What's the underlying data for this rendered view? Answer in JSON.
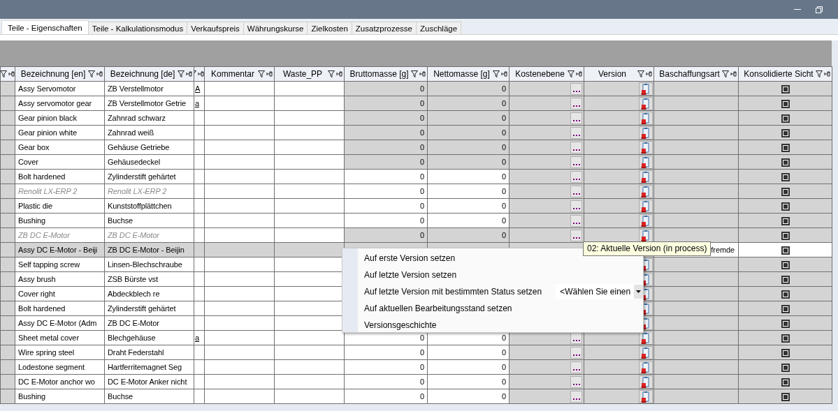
{
  "tabs": [
    {
      "label": "Teile - Eigenschaften",
      "selected": true
    },
    {
      "label": "Teile - Kalkulationsmodus",
      "selected": false
    },
    {
      "label": "Verkaufspreis",
      "selected": false
    },
    {
      "label": "Währungskurse",
      "selected": false
    },
    {
      "label": "Zielkosten",
      "selected": false
    },
    {
      "label": "Zusatzprozesse",
      "selected": false
    },
    {
      "label": "Zuschläge",
      "selected": false
    }
  ],
  "table": {
    "columns": [
      {
        "kind": "rowheader"
      },
      {
        "kind": "text",
        "label": "Bezeichnung [en]"
      },
      {
        "kind": "text",
        "label": "Bezeichnung [de]"
      },
      {
        "kind": "flag"
      },
      {
        "kind": "text",
        "label": "Kommentar"
      },
      {
        "kind": "text",
        "label": "Waste_PP"
      },
      {
        "kind": "number",
        "label": "Bruttomasse [g]"
      },
      {
        "kind": "number",
        "label": "Nettomasse [g]"
      },
      {
        "kind": "cost",
        "label": "Kostenebene"
      },
      {
        "kind": "version",
        "label": "Version"
      },
      {
        "kind": "procurement",
        "label": "Baschaffungsart"
      },
      {
        "kind": "check",
        "label": "Konsolidierte Sicht"
      }
    ],
    "rows": [
      {
        "en": "Assy Servomotor",
        "de": "ZB Verstellmotor",
        "flag": "A",
        "locked": true,
        "inactive": false,
        "selected": false,
        "brutto": "0",
        "netto": "0",
        "cost_button": true,
        "version_icon": true,
        "checked": true
      },
      {
        "en": "Assy servomotor gear",
        "de": "ZB Verstellmotor Getrie",
        "flag": "a",
        "locked": true,
        "inactive": false,
        "selected": false,
        "brutto": "0",
        "netto": "0",
        "cost_button": true,
        "version_icon": true,
        "checked": true
      },
      {
        "en": "Gear pinion black",
        "de": "Zahnrad schwarz",
        "locked": true,
        "inactive": false,
        "selected": false,
        "brutto": "0",
        "netto": "0",
        "cost_button": true,
        "version_icon": true,
        "checked": true
      },
      {
        "en": "Gear pinion white",
        "de": "Zahnrad weiß",
        "locked": true,
        "inactive": false,
        "selected": false,
        "brutto": "0",
        "netto": "0",
        "cost_button": true,
        "version_icon": true,
        "checked": true
      },
      {
        "en": "Gear box",
        "de": "Gehäuse Getriebe",
        "locked": true,
        "inactive": false,
        "selected": false,
        "brutto": "0",
        "netto": "0",
        "cost_button": true,
        "version_icon": true,
        "checked": true
      },
      {
        "en": "Cover",
        "de": "Gehäusedeckel",
        "locked": true,
        "inactive": false,
        "selected": false,
        "brutto": "0",
        "netto": "0",
        "cost_button": true,
        "version_icon": true,
        "checked": true
      },
      {
        "en": "Bolt hardened",
        "de": "Zylinderstift gehärtet",
        "locked": false,
        "inactive": false,
        "selected": false,
        "brutto": "0",
        "netto": "0",
        "cost_button": true,
        "version_icon": true,
        "checked": true
      },
      {
        "en": "Renolit LX-ERP 2",
        "de": "Renolit LX-ERP 2",
        "locked": false,
        "inactive": true,
        "selected": false,
        "brutto": "0",
        "netto": "0",
        "cost_button": true,
        "version_icon": true,
        "checked": true
      },
      {
        "en": "Plastic die",
        "de": "Kunststoffplättchen",
        "locked": false,
        "inactive": false,
        "selected": false,
        "brutto": "0",
        "netto": "0",
        "cost_button": true,
        "version_icon": true,
        "checked": true
      },
      {
        "en": "Bushing",
        "de": "Buchse",
        "locked": false,
        "inactive": false,
        "selected": false,
        "brutto": "0",
        "netto": "0",
        "cost_button": true,
        "version_icon": true,
        "checked": true
      },
      {
        "en": "ZB DC E-Motor",
        "de": "ZB DC E-Motor",
        "locked": true,
        "inactive": true,
        "selected": false,
        "brutto": "0",
        "netto": "0",
        "cost_button": true,
        "version_icon": true,
        "checked": true
      },
      {
        "en": "Assy DC E-Motor - Beiji",
        "de": "ZB DC E-Motor - Beijin",
        "locked": true,
        "inactive": false,
        "selected": true,
        "procurement": "fremde",
        "checked": true
      },
      {
        "en": "Self tapping screw",
        "de": "Linsen-Blechschraube",
        "locked": false,
        "inactive": false,
        "selected": false,
        "version_icon": true,
        "checked": true
      },
      {
        "en": "Assy brush",
        "de": "ZSB Bürste vst",
        "locked": false,
        "inactive": false,
        "selected": false,
        "version_icon": true,
        "checked": true
      },
      {
        "en": "Cover right",
        "de": "Abdeckblech re",
        "locked": false,
        "inactive": false,
        "selected": false,
        "version_icon": true,
        "checked": true
      },
      {
        "en": "Bolt hardened",
        "de": "Zylinderstift gehärtet",
        "locked": false,
        "inactive": false,
        "selected": false,
        "version_icon": true,
        "checked": true
      },
      {
        "en": "Assy DC E-Motor (Adm",
        "de": "ZB DC E-Motor",
        "locked": false,
        "inactive": false,
        "selected": false,
        "version_icon": true,
        "checked": true
      },
      {
        "en": "Sheet metal cover",
        "de": "Blechgehäuse",
        "flag": "a",
        "locked": false,
        "inactive": false,
        "selected": false,
        "brutto": "0",
        "netto": "0",
        "cost_button": true,
        "version_icon": true,
        "checked": true
      },
      {
        "en": "Wire spring steel",
        "de": "Draht Federstahl",
        "locked": false,
        "inactive": false,
        "selected": false,
        "brutto": "0",
        "netto": "0",
        "cost_button": true,
        "version_icon": true,
        "checked": true
      },
      {
        "en": "Lodestone segment",
        "de": "Hartferritemagnet Seg",
        "locked": false,
        "inactive": false,
        "selected": false,
        "brutto": "0",
        "netto": "0",
        "cost_button": true,
        "version_icon": true,
        "checked": true
      },
      {
        "en": "DC E-Motor anchor wo",
        "de": "DC E-Motor Anker nicht",
        "locked": false,
        "inactive": false,
        "selected": false,
        "brutto": "0",
        "netto": "0",
        "cost_button": true,
        "version_icon": true,
        "checked": true
      },
      {
        "en": "Bushing",
        "de": "Buchse",
        "locked": false,
        "inactive": false,
        "selected": false,
        "brutto": "0",
        "netto": "0",
        "cost_button": true,
        "version_icon": true,
        "checked": true
      }
    ]
  },
  "context_menu": {
    "items": [
      {
        "kind": "action",
        "label": "Auf erste Version setzen"
      },
      {
        "kind": "action",
        "label": "Auf letzte Version setzen"
      },
      {
        "kind": "select",
        "label": "Auf letzte Version mit bestimmten Status setzen",
        "value": "<Wählen Sie einen"
      },
      {
        "kind": "action",
        "label": "Auf aktuellen Bearbeitungsstand setzen"
      },
      {
        "kind": "action",
        "label": "Versionsgeschichte"
      }
    ]
  },
  "tooltip": "02: Aktuelle Version (in process)"
}
